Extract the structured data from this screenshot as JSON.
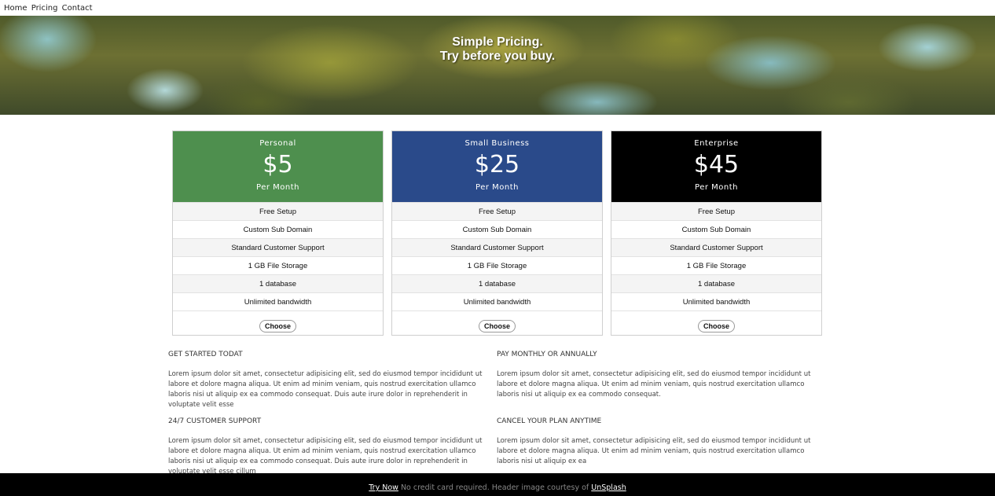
{
  "nav": {
    "items": [
      "Home",
      "Pricing",
      "Contact"
    ]
  },
  "hero": {
    "line1": "Simple Pricing.",
    "line2": "Try before you buy."
  },
  "plans": [
    {
      "name": "Personal",
      "price": "$5",
      "period": "Per Month",
      "color": "#4e8f4e",
      "features": [
        "Free Setup",
        "Custom Sub Domain",
        "Standard Customer Support",
        "1 GB File Storage",
        "1 database",
        "Unlimited bandwidth"
      ],
      "button": "Choose"
    },
    {
      "name": "Small Business",
      "price": "$25",
      "period": "Per Month",
      "color": "#2a4a8a",
      "features": [
        "Free Setup",
        "Custom Sub Domain",
        "Standard Customer Support",
        "1 GB File Storage",
        "1 database",
        "Unlimited bandwidth"
      ],
      "button": "Choose"
    },
    {
      "name": "Enterprise",
      "price": "$45",
      "period": "Per Month",
      "color": "#000000",
      "features": [
        "Free Setup",
        "Custom Sub Domain",
        "Standard Customer Support",
        "1 GB File Storage",
        "1 database",
        "Unlimited bandwidth"
      ],
      "button": "Choose"
    }
  ],
  "info": [
    {
      "title": "GET STARTED TODAT",
      "text": "Lorem ipsum dolor sit amet, consectetur adipisicing elit, sed do eiusmod tempor incididunt ut labore et dolore magna aliqua. Ut enim ad minim veniam, quis nostrud exercitation ullamco laboris nisi ut aliquip ex ea commodo consequat. Duis aute irure dolor in reprehenderit in voluptate velit esse"
    },
    {
      "title": "PAY MONTHLY OR ANNUALLY",
      "text": "Lorem ipsum dolor sit amet, consectetur adipisicing elit, sed do eiusmod tempor incididunt ut labore et dolore magna aliqua. Ut enim ad minim veniam, quis nostrud exercitation ullamco laboris nisi ut aliquip ex ea commodo consequat."
    },
    {
      "title": "24/7 CUSTOMER SUPPORT",
      "text": "Lorem ipsum dolor sit amet, consectetur adipisicing elit, sed do eiusmod tempor incididunt ut labore et dolore magna aliqua. Ut enim ad minim veniam, quis nostrud exercitation ullamco laboris nisi ut aliquip ex ea commodo consequat. Duis aute irure dolor in reprehenderit in voluptate velit esse cillum"
    },
    {
      "title": "CANCEL YOUR PLAN ANYTIME",
      "text": "Lorem ipsum dolor sit amet, consectetur adipisicing elit, sed do eiusmod tempor incididunt ut labore et dolore magna aliqua. Ut enim ad minim veniam, quis nostrud exercitation ullamco laboris nisi ut aliquip ex ea"
    }
  ],
  "footer": {
    "try_now": "Try Now",
    "note": " No credit card required. Header image courtesy of ",
    "credit": "UnSplash"
  }
}
